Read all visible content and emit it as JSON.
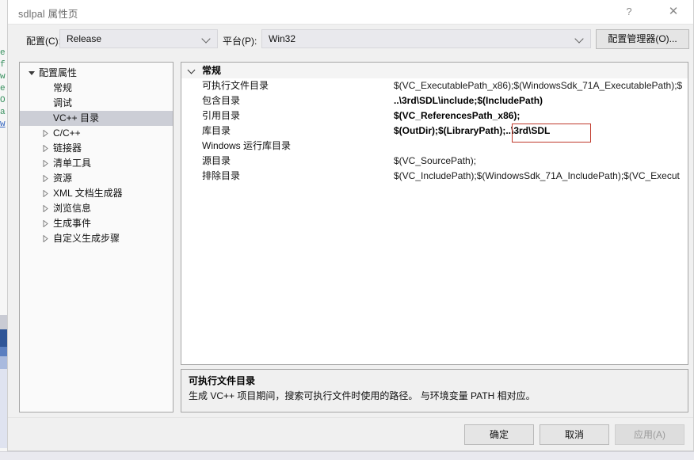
{
  "background": {
    "code_fragments": [
      "e",
      "f",
      "",
      "w",
      "e",
      "O",
      "",
      "a",
      "w"
    ]
  },
  "dialog": {
    "title": "sdlpal 属性页",
    "help_icon": "question-mark-icon",
    "close_icon": "close-icon",
    "toolbar": {
      "config_label": "配置(C):",
      "config_value": "Release",
      "platform_label": "平台(P):",
      "platform_value": "Win32",
      "config_manager_button": "配置管理器(O)..."
    },
    "tree": {
      "items": [
        {
          "label": "配置属性",
          "level": 0,
          "state": "expanded",
          "selected": false
        },
        {
          "label": "常规",
          "level": 1,
          "state": "leaf",
          "selected": false
        },
        {
          "label": "调试",
          "level": 1,
          "state": "leaf",
          "selected": false
        },
        {
          "label": "VC++ 目录",
          "level": 1,
          "state": "leaf",
          "selected": true
        },
        {
          "label": "C/C++",
          "level": 1,
          "state": "collapsed",
          "selected": false
        },
        {
          "label": "链接器",
          "level": 1,
          "state": "collapsed",
          "selected": false
        },
        {
          "label": "清单工具",
          "level": 1,
          "state": "collapsed",
          "selected": false
        },
        {
          "label": "资源",
          "level": 1,
          "state": "collapsed",
          "selected": false
        },
        {
          "label": "XML 文档生成器",
          "level": 1,
          "state": "collapsed",
          "selected": false
        },
        {
          "label": "浏览信息",
          "level": 1,
          "state": "collapsed",
          "selected": false
        },
        {
          "label": "生成事件",
          "level": 1,
          "state": "collapsed",
          "selected": false
        },
        {
          "label": "自定义生成步骤",
          "level": 1,
          "state": "collapsed",
          "selected": false
        }
      ]
    },
    "grid": {
      "section_header": "常规",
      "rows": [
        {
          "name": "可执行文件目录",
          "value": "$(VC_ExecutablePath_x86);$(WindowsSdk_71A_ExecutablePath);$",
          "bold": false
        },
        {
          "name": "包含目录",
          "value": "..\\3rd\\SDL\\include;$(IncludePath)",
          "bold": true
        },
        {
          "name": "引用目录",
          "value": "$(VC_ReferencesPath_x86);",
          "bold": true
        },
        {
          "name": "库目录",
          "value": "$(OutDir);$(LibraryPath);..\\3rd\\SDL",
          "bold": true
        },
        {
          "name": "Windows 运行库目录",
          "value": "",
          "bold": false
        },
        {
          "name": "源目录",
          "value": "$(VC_SourcePath);",
          "bold": false
        },
        {
          "name": "排除目录",
          "value": "$(VC_IncludePath);$(WindowsSdk_71A_IncludePath);$(VC_Execut",
          "bold": false
        }
      ],
      "annotation_color": "#c0392b"
    },
    "description": {
      "title": "可执行文件目录",
      "body": "生成 VC++ 项目期间，搜索可执行文件时使用的路径。   与环境变量 PATH 相对应。"
    },
    "footer": {
      "ok": "确定",
      "cancel": "取消",
      "apply": "应用(A)"
    }
  }
}
